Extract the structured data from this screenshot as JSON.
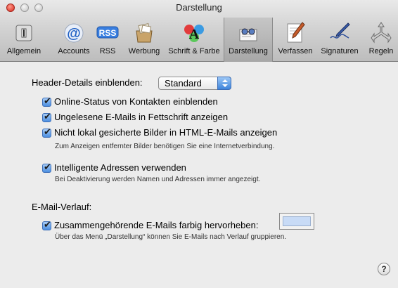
{
  "window": {
    "title": "Darstellung"
  },
  "toolbar": {
    "items": [
      {
        "label": "Allgemein",
        "icon": "switch-icon"
      },
      {
        "label": "Accounts",
        "icon": "at-sign-icon"
      },
      {
        "label": "RSS",
        "icon": "rss-icon"
      },
      {
        "label": "Werbung",
        "icon": "junk-mail-bin-icon"
      },
      {
        "label": "Schrift & Farbe",
        "icon": "font-color-icon"
      },
      {
        "label": "Darstellung",
        "icon": "viewing-glasses-icon",
        "selected": true
      },
      {
        "label": "Verfassen",
        "icon": "compose-pencil-icon"
      },
      {
        "label": "Signaturen",
        "icon": "signature-pen-icon"
      },
      {
        "label": "Regeln",
        "icon": "rules-icon"
      }
    ]
  },
  "header_details": {
    "label": "Header-Details einblenden:",
    "value": "Standard"
  },
  "options": {
    "online_status": {
      "label": "Online-Status von Kontakten einblenden",
      "checked": true
    },
    "unread_bold": {
      "label": "Ungelesene E-Mails in Fettschrift anzeigen",
      "checked": true
    },
    "remote_images": {
      "label": "Nicht lokal gesicherte Bilder in HTML-E-Mails anzeigen",
      "checked": true,
      "hint": "Zum Anzeigen entfernter Bilder benötigen Sie eine Internetverbindung."
    },
    "smart_addresses": {
      "label": "Intelligente Adressen verwenden",
      "checked": true,
      "hint": "Bei Deaktivierung werden Namen und Adressen immer angezeigt."
    }
  },
  "thread": {
    "heading": "E-Mail-Verlauf:",
    "highlight": {
      "label": "Zusammengehörende E-Mails farbig hervorheben:",
      "checked": true,
      "color": "#c8dbf6",
      "hint": "Über das Menü „Darstellung“ können Sie E-Mails nach Verlauf gruppieren."
    }
  },
  "help": {
    "label": "?"
  },
  "colors": {
    "accent": "#3d84db",
    "selected_tab": "#b0b0b0"
  }
}
